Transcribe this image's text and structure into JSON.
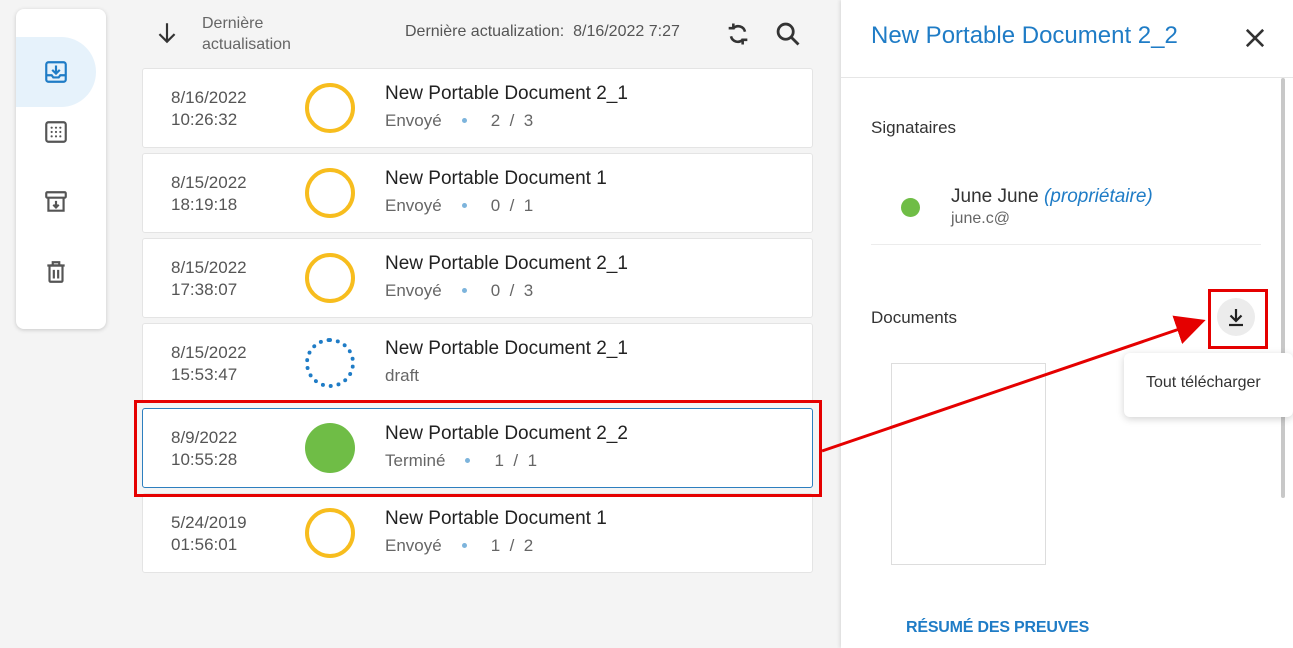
{
  "header": {
    "sort_label": "Dernière actualisation",
    "last_update_label": "Dernière actualization:",
    "last_update_value": "8/16/2022 7:27"
  },
  "documents": [
    {
      "date": "8/16/2022",
      "time": "10:26:32",
      "title": "New Portable Document 2_1",
      "status": "Envoyé",
      "signed": "2",
      "total": "3",
      "state": "pending"
    },
    {
      "date": "8/15/2022",
      "time": "18:19:18",
      "title": "New Portable Document 1",
      "status": "Envoyé",
      "signed": "0",
      "total": "1",
      "state": "pending"
    },
    {
      "date": "8/15/2022",
      "time": "17:38:07",
      "title": "New Portable Document 2_1",
      "status": "Envoyé",
      "signed": "0",
      "total": "3",
      "state": "pending"
    },
    {
      "date": "8/15/2022",
      "time": "15:53:47",
      "title": "New Portable Document 2_1",
      "status": "draft",
      "signed": "",
      "total": "",
      "state": "draft"
    },
    {
      "date": "8/9/2022",
      "time": "10:55:28",
      "title": "New Portable Document 2_2",
      "status": "Terminé",
      "signed": "1",
      "total": "1",
      "state": "done"
    },
    {
      "date": "5/24/2019",
      "time": "01:56:01",
      "title": "New Portable Document 1",
      "status": "Envoyé",
      "signed": "1",
      "total": "2",
      "state": "pending"
    }
  ],
  "panel": {
    "title": "New Portable Document 2_2",
    "signers_label": "Signataires",
    "signer": {
      "name": "June June",
      "role": "(propriétaire)",
      "email": "june.c@"
    },
    "documents_label": "Documents",
    "download_tooltip": "Tout télécharger",
    "proof_link": "RÉSUMÉ DES PREUVES"
  },
  "colors": {
    "accent": "#1f7cc6",
    "pending": "#f7bd1e",
    "done": "#6fbd46",
    "annotation": "#e50000"
  },
  "icons": {
    "rail": [
      "inbox-download-icon",
      "dotted-square-icon",
      "archive-icon",
      "trash-icon"
    ]
  }
}
